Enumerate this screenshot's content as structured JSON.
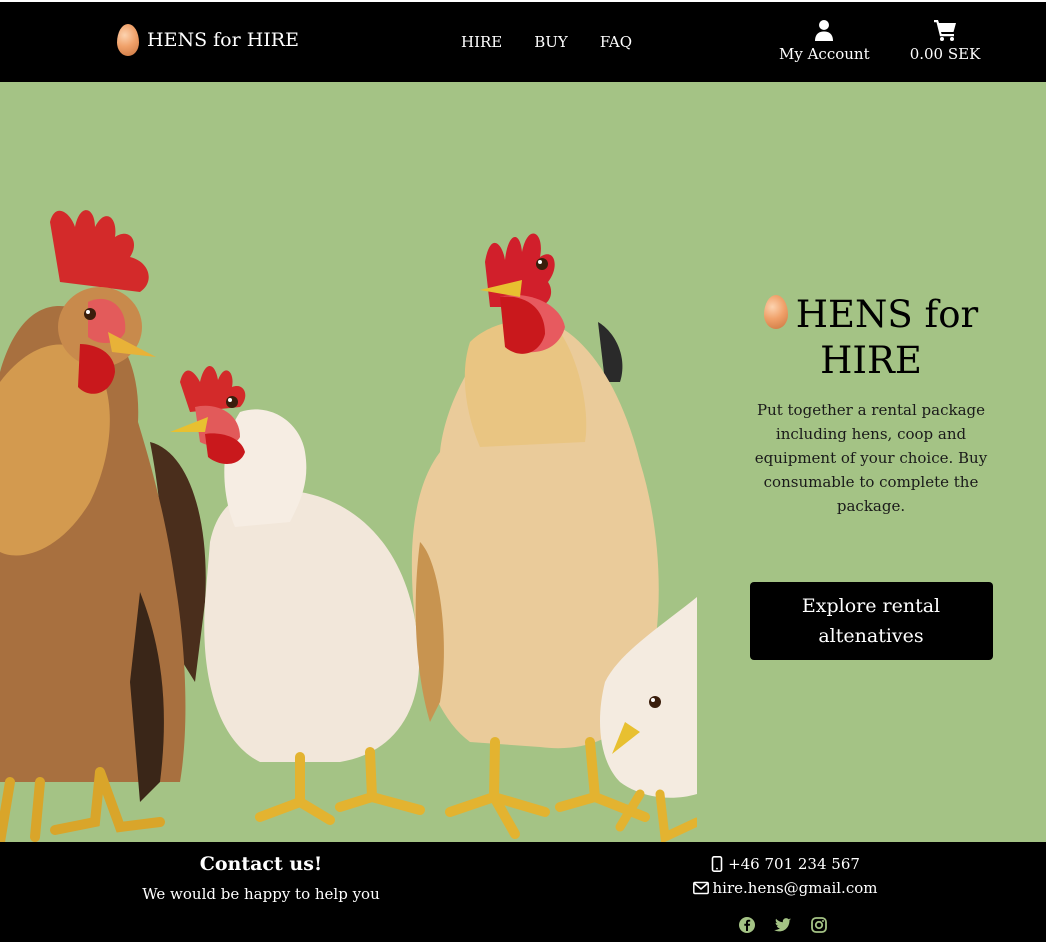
{
  "header": {
    "logo_text": "HENS for HIRE",
    "nav": [
      {
        "label": "HIRE"
      },
      {
        "label": "BUY"
      },
      {
        "label": "FAQ"
      }
    ],
    "account_label": "My Account",
    "cart_total": "0.00 SEK"
  },
  "hero": {
    "title": "HENS for HIRE",
    "description": "Put together a rental package including hens, coop and equipment of your choice. Buy consumable to complete the package.",
    "cta_label": "Explore rental altenatives"
  },
  "footer": {
    "contact_title": "Contact us!",
    "contact_subtitle": "We would be happy to help you",
    "phone": "+46 701 234 567",
    "email": "hire.hens@gmail.com",
    "social_icons": [
      "facebook-icon",
      "twitter-icon",
      "instagram-icon"
    ]
  },
  "colors": {
    "header_bg": "#000000",
    "hero_bg": "#a4c385",
    "cta_bg": "#000000",
    "footer_bg": "#000000",
    "social_icon": "#a4c385"
  }
}
